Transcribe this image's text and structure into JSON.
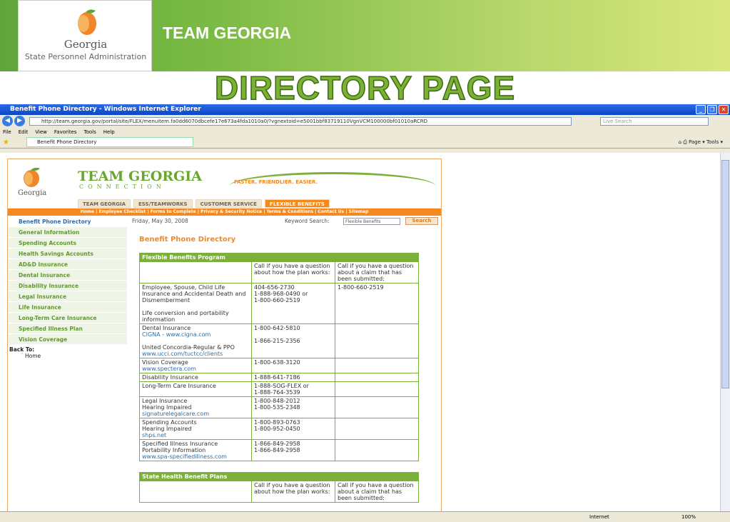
{
  "slide": {
    "brand_logo_text": "Georgia",
    "brand_logo_sub": "State Personnel Administration",
    "title": "TEAM GEORGIA",
    "heading": "DIRECTORY PAGE"
  },
  "browser": {
    "window_title": "Benefit Phone Directory - Windows Internet Explorer",
    "url": "http://team.georgia.gov/portal/site/FLEX/menuitem.fa0dd6070dbcefe17e673a4fda1010a0/?vgnextoid=e5001bbf83719110VgnVCM100000bf01010aRCRD",
    "search_placeholder": "Live Search",
    "menu": [
      "File",
      "Edit",
      "View",
      "Favorites",
      "Tools",
      "Help"
    ],
    "tab_label": "Benefit Phone Directory",
    "page_btn": "Page ▾",
    "tools_btn": "Tools ▾",
    "status_zone": "Internet",
    "status_zoom": "100%"
  },
  "site": {
    "name": "TEAM GEORGIA",
    "connection": "CONNECTION",
    "georgia": "Georgia",
    "tagline": "FASTER. FRIENDLIER. EASIER.",
    "tabs": [
      "TEAM GEORGIA",
      "ESS/TEAMWORKS",
      "CUSTOMER SERVICE",
      "FLEXIBLE BENEFITS"
    ],
    "links": "Home | Employee Checklist | Forms to Complete | Privacy & Security Notice | Terms & Conditions | Contact Us | Sitemap",
    "nav": [
      "Benefit Phone Directory",
      "General Information",
      "Spending Accounts",
      "Health Savings Accounts",
      "AD&D Insurance",
      "Dental Insurance",
      "Disability Insurance",
      "Legal Insurance",
      "Life Insurance",
      "Long-Term Care Insurance",
      "Specified Illness Plan",
      "Vision Coverage"
    ],
    "back_to": "Back To:",
    "back_home": "Home",
    "date": "Friday, May 30, 2008",
    "keyword_label": "Keyword Search:",
    "keyword_value": "Flexible Benefits",
    "search_btn": "Search",
    "page_heading": "Benefit Phone Directory",
    "table1": {
      "title": "Flexible Benefits Program",
      "col_how": "Call if you have a question about how the plan works:",
      "col_claim": "Call if you have a question about a claim that has been submitted:",
      "rows": [
        {
          "plan": [
            "Employee, Spouse, Child Life Insurance and Accidental Death and Dismemberment",
            "",
            "Life conversion and portability information"
          ],
          "how": "404-656-2730\n1-888-968-0490 or\n1-800-660-2519",
          "claim": "1-800-660-2519"
        },
        {
          "plan": [
            "Dental Insurance",
            "CIGNA - www.cigna.com",
            "",
            "United Concordia-Regular & PPO",
            "www.ucci.com/tuctcc/clients"
          ],
          "how": "1-800-642-5810\n\n1-866-215-2356",
          "claim": ""
        },
        {
          "plan": [
            "Vision Coverage",
            "www.spectera.com"
          ],
          "how": "1-800-638-3120",
          "claim": ""
        },
        {
          "plan": [
            "Disability Insurance"
          ],
          "how": "1-888-641-7186",
          "claim": ""
        },
        {
          "plan": [
            "Long-Term Care Insurance"
          ],
          "how": "1-888-SOG-FLEX or\n1-888-764-3539",
          "claim": ""
        },
        {
          "plan": [
            "Legal Insurance",
            "Hearing Impaired",
            "signaturelegalcare.com"
          ],
          "how": "1-800-848-2012\n1-800-535-2348",
          "claim": ""
        },
        {
          "plan": [
            "Spending Accounts",
            "Hearing Impaired",
            "shps.net"
          ],
          "how": "1-800-893-0763\n1-800-952-0450",
          "claim": ""
        },
        {
          "plan": [
            "Specified Illness Insurance",
            "Portability Information",
            "www.spa-specifiedillness.com"
          ],
          "how": "1-866-849-2958\n1-866-849-2958",
          "claim": ""
        }
      ]
    },
    "table2": {
      "title": "State Health Benefit Plans",
      "col_how": "Call if you have a question about how the plan works:",
      "col_claim": "Call if you have a question about a claim that has been submitted:"
    }
  }
}
